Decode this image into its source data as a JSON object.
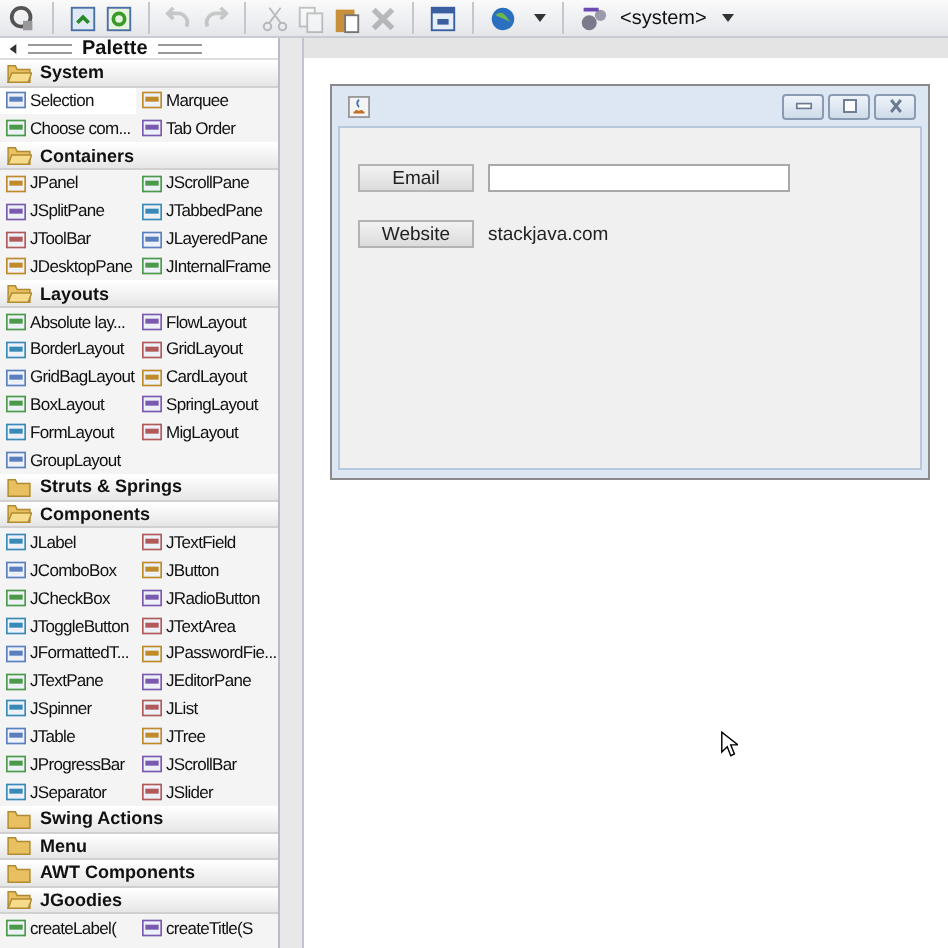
{
  "toolbar": [
    {
      "kind": "test",
      "disabled": false
    },
    {
      "kind": "separator"
    },
    {
      "kind": "source",
      "disabled": false
    },
    {
      "kind": "refresh",
      "disabled": false
    },
    {
      "kind": "separator"
    },
    {
      "kind": "undo",
      "disabled": true
    },
    {
      "kind": "redo",
      "disabled": true
    },
    {
      "kind": "separator"
    },
    {
      "kind": "cut",
      "disabled": true
    },
    {
      "kind": "copy",
      "disabled": true
    },
    {
      "kind": "paste",
      "disabled": false
    },
    {
      "kind": "delete",
      "disabled": true
    },
    {
      "kind": "separator"
    },
    {
      "kind": "form",
      "disabled": false
    },
    {
      "kind": "separator"
    },
    {
      "kind": "globe",
      "disabled": false
    },
    {
      "kind": "caret"
    },
    {
      "kind": "separator"
    }
  ],
  "look_and_feel": {
    "label": "<system>"
  },
  "palette": {
    "title": "Palette",
    "categories": [
      {
        "name": "System",
        "expanded": true,
        "items": [
          {
            "label": "Selection",
            "selected": true
          },
          {
            "label": "Marquee",
            "selected": false
          },
          {
            "label": "Choose com...",
            "selected": false
          },
          {
            "label": "Tab Order",
            "selected": false
          }
        ]
      },
      {
        "name": "Containers",
        "expanded": true,
        "items": [
          {
            "label": "JPanel",
            "selected": false
          },
          {
            "label": "JScrollPane",
            "selected": false
          },
          {
            "label": "JSplitPane",
            "selected": false
          },
          {
            "label": "JTabbedPane",
            "selected": false
          },
          {
            "label": "JToolBar",
            "selected": false
          },
          {
            "label": "JLayeredPane",
            "selected": false
          },
          {
            "label": "JDesktopPane",
            "selected": false
          },
          {
            "label": "JInternalFrame",
            "selected": false
          }
        ]
      },
      {
        "name": "Layouts",
        "expanded": true,
        "items": [
          {
            "label": "Absolute lay...",
            "selected": false
          },
          {
            "label": "FlowLayout",
            "selected": false
          },
          {
            "label": "BorderLayout",
            "selected": false
          },
          {
            "label": "GridLayout",
            "selected": false
          },
          {
            "label": "GridBagLayout",
            "selected": false
          },
          {
            "label": "CardLayout",
            "selected": false
          },
          {
            "label": "BoxLayout",
            "selected": false
          },
          {
            "label": "SpringLayout",
            "selected": false
          },
          {
            "label": "FormLayout",
            "selected": false
          },
          {
            "label": "MigLayout",
            "selected": false
          },
          {
            "label": "GroupLayout",
            "selected": false
          }
        ]
      },
      {
        "name": "Struts & Springs",
        "expanded": false
      },
      {
        "name": "Components",
        "expanded": true,
        "items": [
          {
            "label": "JLabel",
            "selected": false
          },
          {
            "label": "JTextField",
            "selected": false
          },
          {
            "label": "JComboBox",
            "selected": false
          },
          {
            "label": "JButton",
            "selected": false
          },
          {
            "label": "JCheckBox",
            "selected": false
          },
          {
            "label": "JRadioButton",
            "selected": false
          },
          {
            "label": "JToggleButton",
            "selected": false
          },
          {
            "label": "JTextArea",
            "selected": false
          },
          {
            "label": "JFormattedT...",
            "selected": false
          },
          {
            "label": "JPasswordFie...",
            "selected": false
          },
          {
            "label": "JTextPane",
            "selected": false
          },
          {
            "label": "JEditorPane",
            "selected": false
          },
          {
            "label": "JSpinner",
            "selected": false
          },
          {
            "label": "JList",
            "selected": false
          },
          {
            "label": "JTable",
            "selected": false
          },
          {
            "label": "JTree",
            "selected": false
          },
          {
            "label": "JProgressBar",
            "selected": false
          },
          {
            "label": "JScrollBar",
            "selected": false
          },
          {
            "label": "JSeparator",
            "selected": false
          },
          {
            "label": "JSlider",
            "selected": false
          }
        ]
      },
      {
        "name": "Swing Actions",
        "expanded": false
      },
      {
        "name": "Menu",
        "expanded": false
      },
      {
        "name": "AWT Components",
        "expanded": false
      },
      {
        "name": "JGoodies",
        "expanded": true,
        "items": [
          {
            "label": "createLabel(",
            "selected": false
          },
          {
            "label": "createTitle(S",
            "selected": false
          }
        ]
      }
    ]
  },
  "form": {
    "rows": [
      {
        "button": "Email",
        "kind": "field"
      },
      {
        "button": "Website",
        "kind": "label",
        "text": "stackjava.com"
      }
    ]
  }
}
